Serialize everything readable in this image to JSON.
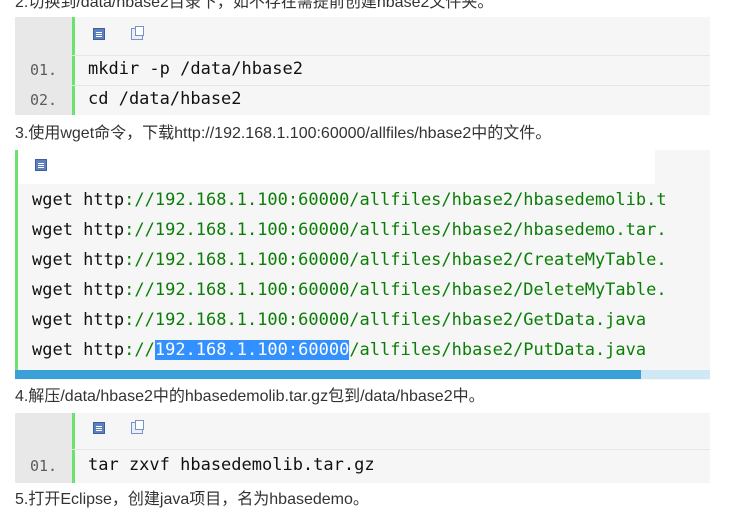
{
  "paragraphs": {
    "p2": "2.切换到/data/hbase2目录下，如不存在需提前创建hbase2文件夹。",
    "p3": "3.使用wget命令，下载http://192.168.1.100:60000/allfiles/hbase2中的文件。",
    "p4": "4.解压/data/hbase2中的hbasedemolib.tar.gz包到/data/hbase2中。",
    "p5": "5.打开Eclipse，创建java项目，名为hbasedemo。"
  },
  "toolbar": {
    "view_icon": "view-source-icon",
    "copy_icon": "copy-icon"
  },
  "block1": {
    "lines": [
      {
        "num": "01.",
        "code": "mkdir -p /data/hbase2"
      },
      {
        "num": "02.",
        "code": "cd /data/hbase2"
      }
    ]
  },
  "block2": {
    "lines": [
      {
        "cmd": "wget http",
        "sep": "://",
        "url": "192.168.1.100:60000/allfiles/hbase2/hbasedemolib.t"
      },
      {
        "cmd": "wget http",
        "sep": "://",
        "url": "192.168.1.100:60000/allfiles/hbase2/hbasedemo.tar."
      },
      {
        "cmd": "wget http",
        "sep": "://",
        "url": "192.168.1.100:60000/allfiles/hbase2/CreateMyTable."
      },
      {
        "cmd": "wget http",
        "sep": "://",
        "url": "192.168.1.100:60000/allfiles/hbase2/DeleteMyTable."
      },
      {
        "cmd": "wget http",
        "sep": "://",
        "url": "192.168.1.100:60000/allfiles/hbase2/GetData.java"
      }
    ],
    "last_line": {
      "cmd": "wget http",
      "sep": "://",
      "selected": "192.168.1.100:60000",
      "rest": "/allfiles/hbase2/PutData.java"
    },
    "scroll_fraction": 0.9
  },
  "block3": {
    "lines": [
      {
        "num": "01.",
        "code": "tar zxvf hbasedemolib.tar.gz"
      }
    ]
  },
  "colors": {
    "gutter_accent": "#6ce26c",
    "url": "#0a7e07",
    "selection": "#3390ff"
  }
}
